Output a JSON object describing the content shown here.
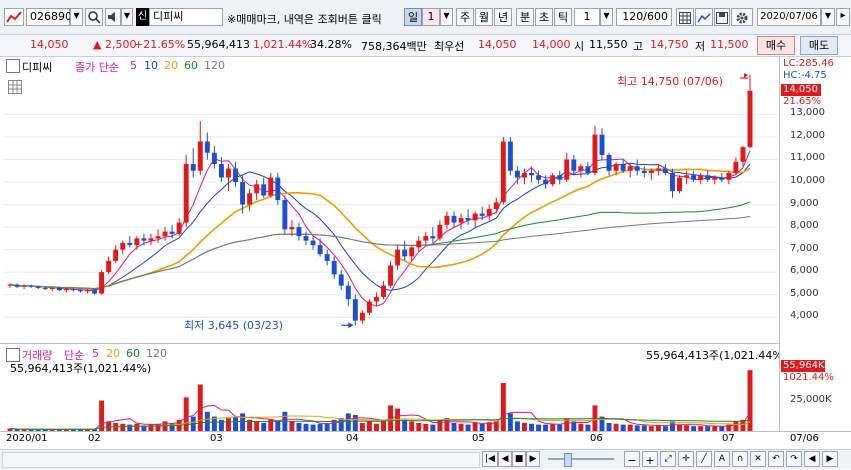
{
  "toolbar": {
    "code": "026890",
    "name": "디피씨",
    "notice": "※매매마크, 내역은 조회버튼 클릭",
    "period_buttons": [
      "일",
      "1",
      "주",
      "월",
      "년",
      "분",
      "초",
      "틱"
    ],
    "tick_value": "1",
    "count": "120/600",
    "date": "2020/07/06"
  },
  "quote": {
    "price": "14,050",
    "change": "▲ 2,500",
    "change_pct": "+21.65%",
    "volume": "55,964,413",
    "volume_pct": "1,021.44%",
    "turnover": "34.28%",
    "amount": "758,364백만",
    "best_label": "최우선",
    "ask": "14,050",
    "bid": "14,000",
    "open_label": "시",
    "open": "11,550",
    "high_label": "고",
    "high": "14,750",
    "low_label": "저",
    "low": "11,500",
    "buy_label": "매수",
    "sell_label": "매도"
  },
  "legend": {
    "name": "디피씨",
    "ma_label": "종가 단순",
    "periods": [
      "5",
      "10",
      "20",
      "60",
      "120"
    ],
    "volume_label": "거래량",
    "vol_ma_label": "단순",
    "vol_periods": [
      "5",
      "20",
      "60",
      "120"
    ]
  },
  "annotations": {
    "high": "최고 14,750 (07/06)",
    "low": "최저 3,645 (03/23)",
    "vol_right": "55,964,413주(1,021.44%)",
    "vol_left": "55,964,413주(1,021.44%)"
  },
  "axis_tags": {
    "lc": "LC:285.46",
    "hc": "HC:-4.75",
    "price": "14,050",
    "pct": "21.65%",
    "vol": "55,964K",
    "vol_pct": "1021.44%"
  },
  "colors": {
    "up": "#e0191b",
    "down": "#1e4fd0",
    "ma5": "#d81b8c",
    "ma10": "#1e3fd0",
    "ma20": "#e8a000",
    "ma60": "#138a2e",
    "ma120": "#7a7a7a"
  },
  "chart_data": {
    "type": "candlestick",
    "price_ticks": [
      "13,000",
      "12,000",
      "11,000",
      "10,000",
      "9,000",
      "8,000",
      "7,000",
      "6,000",
      "5,000",
      "4,000"
    ],
    "volume_ticks": [
      "25,000K"
    ],
    "x_labels": [
      "2020/01",
      "02",
      "03",
      "04",
      "05",
      "06",
      "07",
      "07/06"
    ],
    "candles": [
      [
        5400,
        5500,
        5300,
        5450
      ],
      [
        5450,
        5500,
        5300,
        5350
      ],
      [
        5350,
        5450,
        5250,
        5400
      ],
      [
        5400,
        5450,
        5300,
        5350
      ],
      [
        5350,
        5400,
        5250,
        5300
      ],
      [
        5300,
        5350,
        5200,
        5250
      ],
      [
        5250,
        5350,
        5150,
        5300
      ],
      [
        5300,
        5350,
        5150,
        5200
      ],
      [
        5200,
        5300,
        5100,
        5250
      ],
      [
        5250,
        5300,
        5150,
        5200
      ],
      [
        5200,
        5250,
        5100,
        5150
      ],
      [
        5150,
        5250,
        5050,
        5200
      ],
      [
        5200,
        5250,
        5000,
        5050
      ],
      [
        5050,
        6100,
        5000,
        6000
      ],
      [
        6000,
        6700,
        5900,
        6500
      ],
      [
        6500,
        7200,
        6400,
        7000
      ],
      [
        7000,
        7400,
        6800,
        7300
      ],
      [
        7300,
        7600,
        7100,
        7200
      ],
      [
        7200,
        7600,
        7000,
        7500
      ],
      [
        7500,
        7700,
        7200,
        7400
      ],
      [
        7400,
        7700,
        7200,
        7500
      ],
      [
        7500,
        7900,
        7300,
        7600
      ],
      [
        7600,
        8000,
        7400,
        7800
      ],
      [
        7800,
        8100,
        7500,
        7700
      ],
      [
        7700,
        8400,
        7600,
        8200
      ],
      [
        8200,
        11200,
        8000,
        10800
      ],
      [
        10800,
        11500,
        10200,
        10500
      ],
      [
        10500,
        12700,
        10300,
        11800
      ],
      [
        11800,
        12200,
        11000,
        11300
      ],
      [
        11300,
        11600,
        10600,
        10800
      ],
      [
        10800,
        11100,
        10000,
        10200
      ],
      [
        10200,
        10800,
        9600,
        10600
      ],
      [
        10600,
        10900,
        9800,
        10000
      ],
      [
        10000,
        10300,
        8600,
        9000
      ],
      [
        9000,
        9700,
        8700,
        9500
      ],
      [
        9500,
        10100,
        9200,
        9900
      ],
      [
        9900,
        10200,
        9300,
        9400
      ],
      [
        9400,
        10400,
        9300,
        10200
      ],
      [
        10200,
        10400,
        9000,
        9200
      ],
      [
        9200,
        9400,
        7700,
        7900
      ],
      [
        7900,
        8300,
        7600,
        8000
      ],
      [
        8000,
        8200,
        7400,
        7600
      ],
      [
        7600,
        7800,
        7200,
        7400
      ],
      [
        7400,
        7600,
        7000,
        7200
      ],
      [
        7200,
        7500,
        6700,
        6800
      ],
      [
        6800,
        7000,
        6300,
        6500
      ],
      [
        6500,
        6700,
        5700,
        5900
      ],
      [
        5900,
        6100,
        5200,
        5400
      ],
      [
        5400,
        5600,
        4500,
        4800
      ],
      [
        4800,
        5000,
        3645,
        3850
      ],
      [
        3850,
        4300,
        3700,
        4200
      ],
      [
        4200,
        4800,
        4100,
        4700
      ],
      [
        4700,
        5100,
        4500,
        4900
      ],
      [
        4900,
        5600,
        4800,
        5400
      ],
      [
        5400,
        6500,
        5300,
        6300
      ],
      [
        6300,
        7200,
        6100,
        7000
      ],
      [
        7000,
        7400,
        6500,
        6700
      ],
      [
        6700,
        7200,
        6500,
        7100
      ],
      [
        7100,
        7600,
        6900,
        7400
      ],
      [
        7400,
        7800,
        7200,
        7600
      ],
      [
        7600,
        8000,
        7300,
        7500
      ],
      [
        7500,
        8300,
        7400,
        8100
      ],
      [
        8100,
        8700,
        7900,
        8500
      ],
      [
        8500,
        8700,
        8000,
        8200
      ],
      [
        8200,
        8600,
        7900,
        8400
      ],
      [
        8400,
        8800,
        8100,
        8300
      ],
      [
        8300,
        8700,
        8000,
        8600
      ],
      [
        8600,
        8900,
        8300,
        8500
      ],
      [
        8500,
        9000,
        8300,
        8800
      ],
      [
        8800,
        9300,
        8600,
        9100
      ],
      [
        9100,
        12000,
        9000,
        11800
      ],
      [
        11800,
        12000,
        10300,
        10500
      ],
      [
        10500,
        10700,
        9900,
        10200
      ],
      [
        10200,
        10600,
        9900,
        10400
      ],
      [
        10400,
        10700,
        10000,
        10300
      ],
      [
        10300,
        10500,
        9900,
        10100
      ],
      [
        10100,
        10300,
        9700,
        9900
      ],
      [
        9900,
        10400,
        9800,
        10300
      ],
      [
        10300,
        10500,
        9900,
        10100
      ],
      [
        10100,
        11300,
        10000,
        11000
      ],
      [
        11000,
        11200,
        10300,
        10500
      ],
      [
        10500,
        10800,
        10200,
        10700
      ],
      [
        10700,
        10900,
        10300,
        10400
      ],
      [
        10400,
        12500,
        10300,
        12100
      ],
      [
        12100,
        12400,
        11000,
        11200
      ],
      [
        11200,
        11300,
        10300,
        10500
      ],
      [
        10500,
        10900,
        10300,
        10800
      ],
      [
        10800,
        11000,
        10400,
        10500
      ],
      [
        10500,
        10800,
        10200,
        10700
      ],
      [
        10700,
        11000,
        10300,
        10500
      ],
      [
        10500,
        10700,
        10200,
        10400
      ],
      [
        10400,
        10600,
        10100,
        10500
      ],
      [
        10500,
        10800,
        10300,
        10600
      ],
      [
        10600,
        10800,
        10300,
        10400
      ],
      [
        10400,
        10600,
        9300,
        9600
      ],
      [
        9600,
        10300,
        9500,
        10200
      ],
      [
        10200,
        10500,
        9900,
        10300
      ],
      [
        10300,
        10500,
        10000,
        10100
      ],
      [
        10100,
        10400,
        9900,
        10300
      ],
      [
        10300,
        10500,
        10000,
        10100
      ],
      [
        10100,
        10300,
        9900,
        10200
      ],
      [
        10200,
        10400,
        10000,
        10100
      ],
      [
        10100,
        10500,
        9900,
        10400
      ],
      [
        10400,
        11100,
        10300,
        10900
      ],
      [
        10900,
        11600,
        10700,
        11550
      ],
      [
        11550,
        14750,
        11500,
        14050
      ]
    ],
    "volumes": [
      3,
      2,
      2,
      2,
      2,
      2,
      2,
      2,
      2,
      2,
      2,
      2,
      2,
      38,
      12,
      10,
      9,
      8,
      9,
      7,
      8,
      9,
      12,
      10,
      14,
      42,
      18,
      58,
      24,
      18,
      14,
      16,
      18,
      22,
      14,
      12,
      10,
      15,
      12,
      24,
      12,
      10,
      9,
      8,
      9,
      10,
      14,
      16,
      22,
      20,
      10,
      12,
      9,
      14,
      32,
      28,
      14,
      12,
      10,
      9,
      8,
      14,
      16,
      10,
      9,
      8,
      10,
      9,
      11,
      12,
      60,
      22,
      12,
      10,
      9,
      8,
      8,
      9,
      8,
      16,
      12,
      9,
      8,
      32,
      18,
      10,
      9,
      8,
      8,
      7,
      7,
      6,
      7,
      6,
      12,
      8,
      7,
      6,
      6,
      6,
      6,
      6,
      8,
      12,
      14,
      76
    ]
  }
}
